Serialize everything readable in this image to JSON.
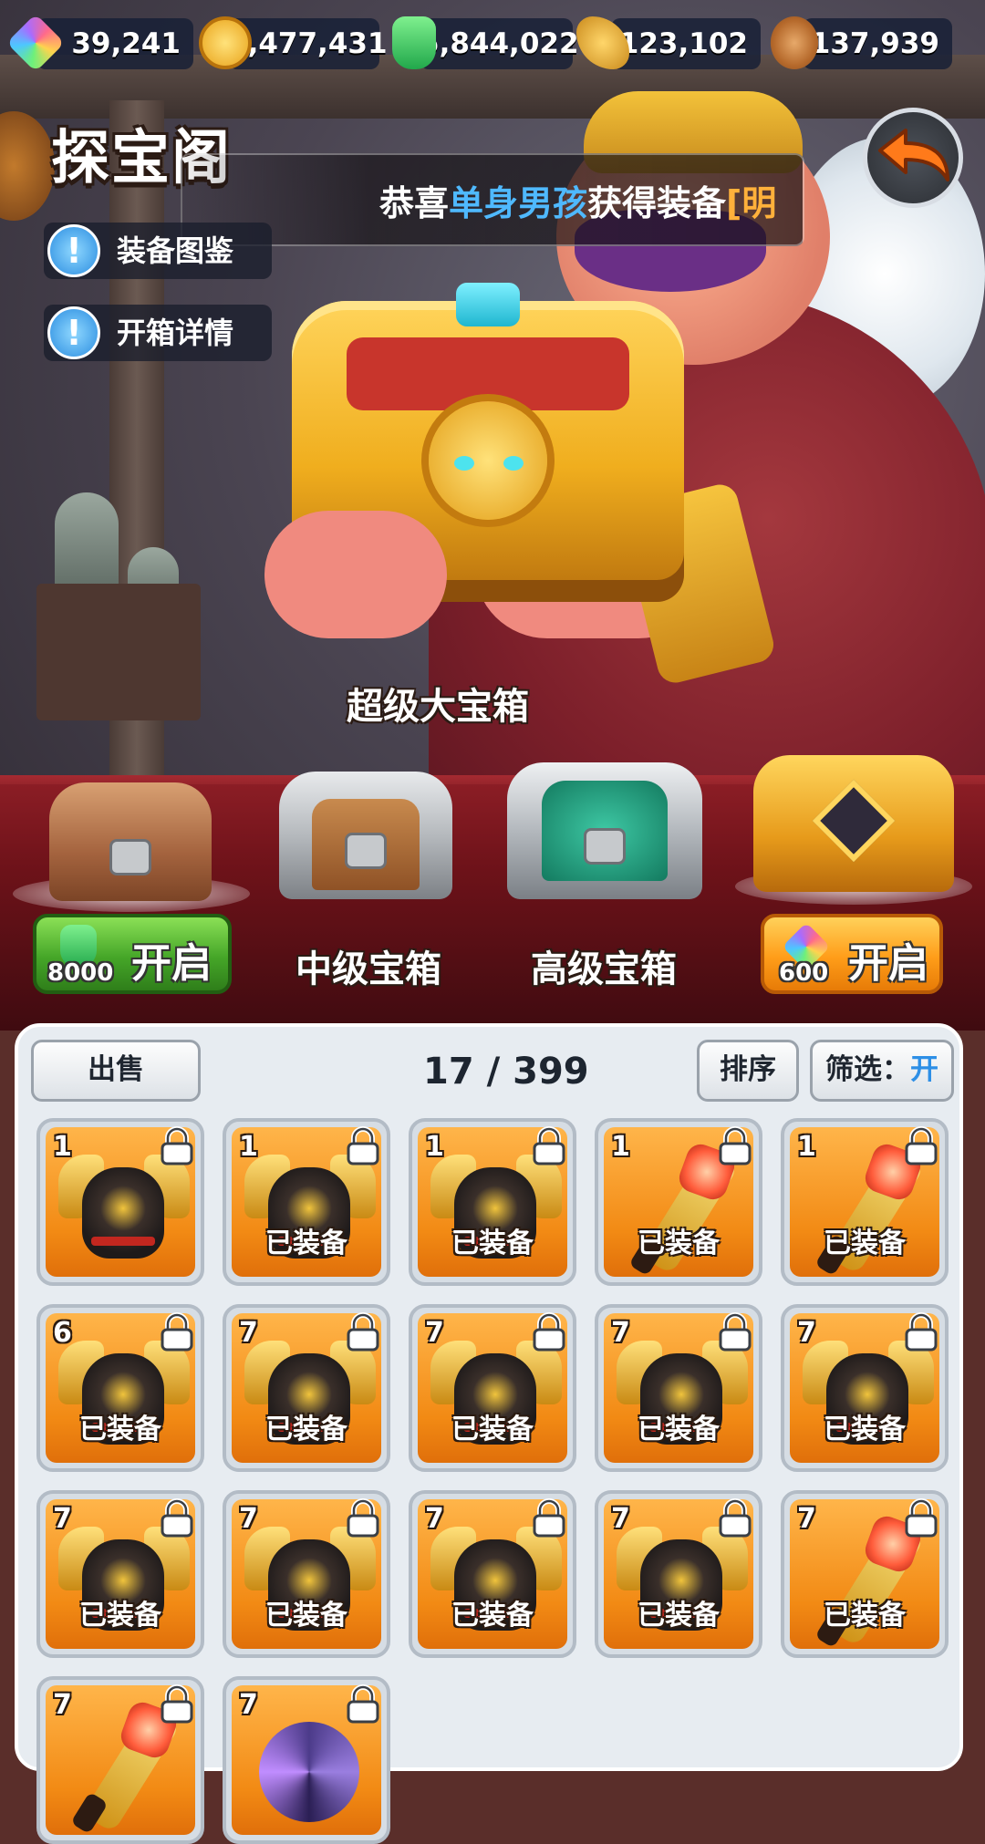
{
  "resources": [
    {
      "icon": "gem-icon",
      "value": "39,241"
    },
    {
      "icon": "gold-coin-icon",
      "value": "2,477,431"
    },
    {
      "icon": "jade-icon",
      "value": "5,844,022"
    },
    {
      "icon": "wheat-icon",
      "value": "123,102"
    },
    {
      "icon": "wood-log-icon",
      "value": "137,939"
    }
  ],
  "header": {
    "title": "探宝阁",
    "notice": {
      "prefix": "恭喜",
      "user": "单身男孩",
      "middle": "获得装备",
      "item": "[明"
    }
  },
  "side_buttons": [
    {
      "label": "装备图鉴",
      "icon": "exclamation-icon"
    },
    {
      "label": "开箱详情",
      "icon": "exclamation-icon"
    }
  ],
  "chests": {
    "featured_label": "超级大宝箱",
    "tiers": [
      {
        "name": "",
        "open_label": "开启",
        "cost": "8000",
        "currency_icon": "jade-icon"
      },
      {
        "name": "中级宝箱"
      },
      {
        "name": "高级宝箱"
      },
      {
        "name": "",
        "open_label": "开启",
        "cost": "600",
        "currency_icon": "gem-icon"
      }
    ]
  },
  "inventory": {
    "sell_label": "出售",
    "count": "17 / 399",
    "sort_label": "排序",
    "filter_label": "筛选：",
    "filter_value": "开",
    "items": [
      {
        "level": "1",
        "art": "armor",
        "equipped": ""
      },
      {
        "level": "1",
        "art": "armor",
        "equipped": "已装备"
      },
      {
        "level": "1",
        "art": "armor",
        "equipped": "已装备"
      },
      {
        "level": "1",
        "art": "weapon",
        "equipped": "已装备"
      },
      {
        "level": "1",
        "art": "weapon",
        "equipped": "已装备"
      },
      {
        "level": "6",
        "art": "armor",
        "equipped": "已装备"
      },
      {
        "level": "7",
        "art": "armor",
        "equipped": "已装备"
      },
      {
        "level": "7",
        "art": "armor",
        "equipped": "已装备"
      },
      {
        "level": "7",
        "art": "armor",
        "equipped": "已装备"
      },
      {
        "level": "7",
        "art": "armor",
        "equipped": "已装备"
      },
      {
        "level": "7",
        "art": "armor",
        "equipped": "已装备"
      },
      {
        "level": "7",
        "art": "armor",
        "equipped": "已装备"
      },
      {
        "level": "7",
        "art": "armor",
        "equipped": "已装备"
      },
      {
        "level": "7",
        "art": "armor",
        "equipped": "已装备"
      },
      {
        "level": "7",
        "art": "weapon",
        "equipped": "已装备"
      },
      {
        "level": "7",
        "art": "weapon",
        "equipped": ""
      },
      {
        "level": "7",
        "art": "orb",
        "equipped": ""
      }
    ]
  },
  "colors": {
    "accent_blue": "#4fb9ff",
    "accent_orange": "#ffb13b",
    "button_green": "#45a628",
    "button_orange": "#ff9d19",
    "card_orange": "#f28a14"
  }
}
